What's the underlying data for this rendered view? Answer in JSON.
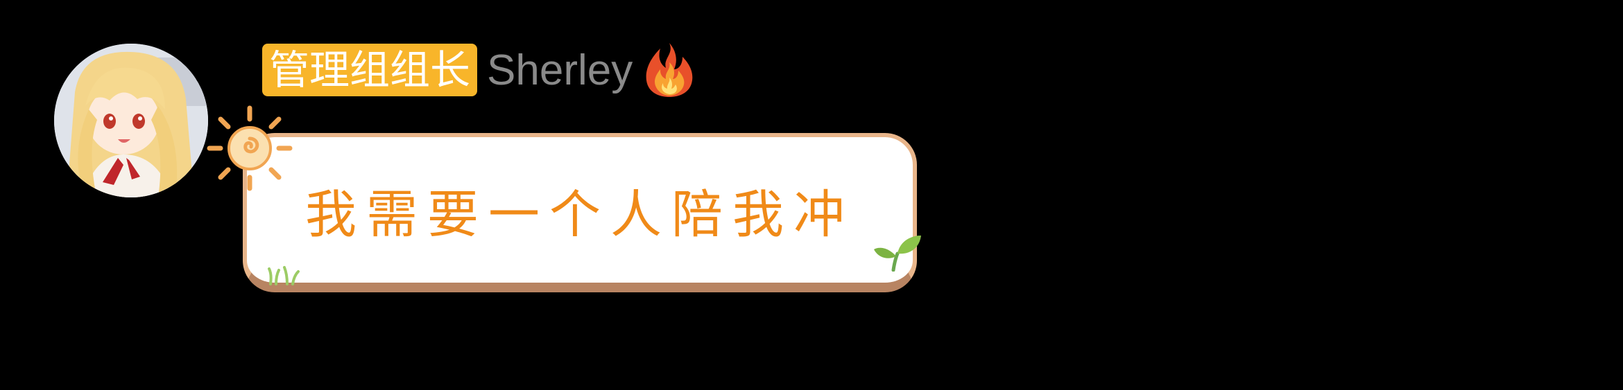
{
  "message": {
    "sender": {
      "role_badge": "管理组组长",
      "name": "Sherley",
      "badge_color": "#f8b52a",
      "name_color": "#8a8a8a",
      "status_icon": "fire-icon"
    },
    "bubble": {
      "text": "我需要一个人陪我冲",
      "text_color": "#f08a18",
      "decorations": [
        "sun-icon",
        "sprout-icon",
        "grass-icon"
      ]
    }
  }
}
